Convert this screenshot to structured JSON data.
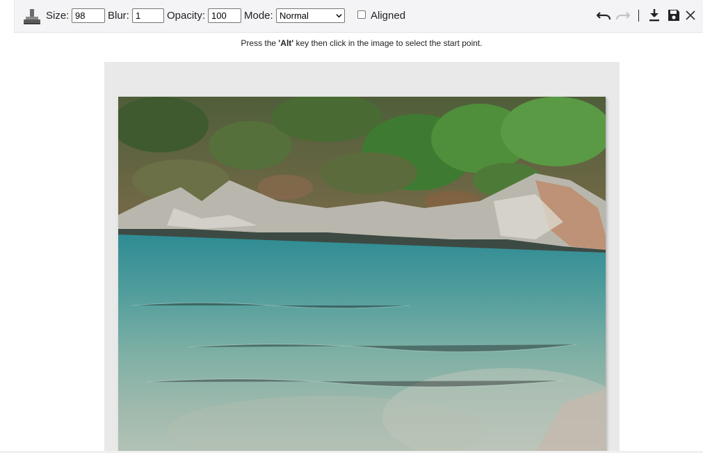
{
  "toolbar": {
    "tool_icon": "clone-stamp-icon",
    "size_label": "Size:",
    "size_value": "98",
    "blur_label": "Blur:",
    "blur_value": "1",
    "opacity_label": "Opacity:",
    "opacity_value": "100",
    "mode_label": "Mode:",
    "mode_value": "Normal",
    "aligned_label": "Aligned",
    "aligned_checked": false,
    "actions": [
      {
        "name": "undo-icon"
      },
      {
        "name": "redo-icon",
        "disabled": true
      },
      {
        "name": "download-icon"
      },
      {
        "name": "save-icon"
      },
      {
        "name": "close-icon"
      }
    ],
    "separator": "|"
  },
  "hint": {
    "before": "Press the ",
    "key": "'Alt'",
    "after": " key then click in the image to select the start point."
  },
  "canvas": {
    "background": "#e9e9e9",
    "image_subject": "rocky cove with turquoise water and green shrubs"
  }
}
